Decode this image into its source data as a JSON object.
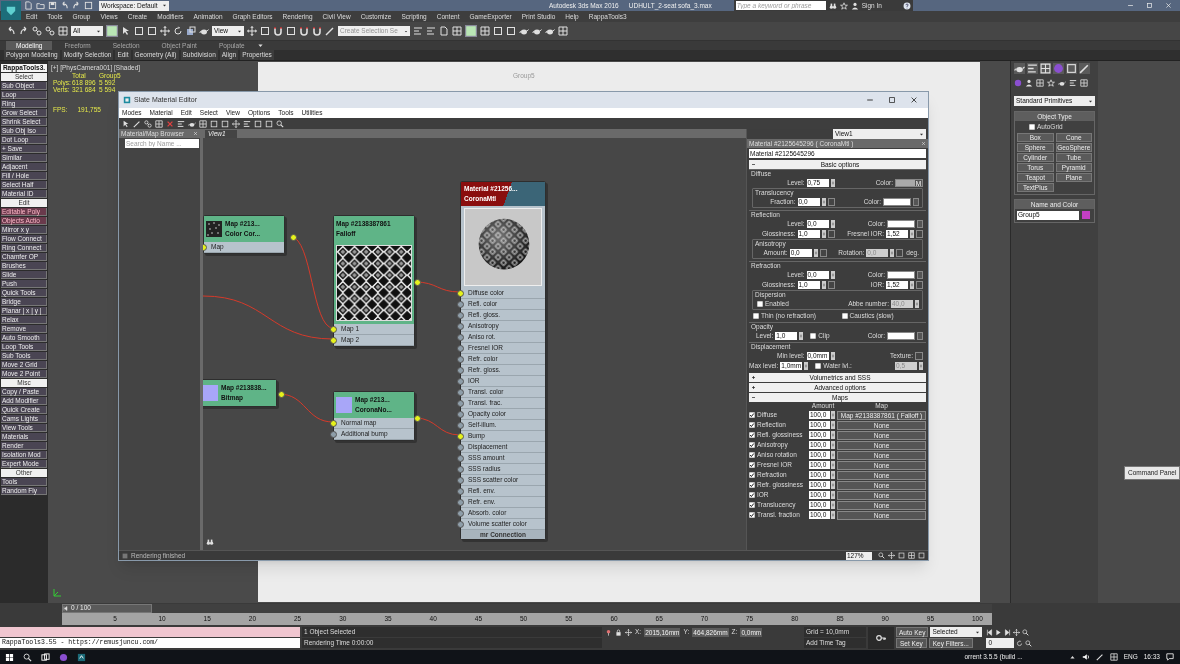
{
  "app": {
    "workspace": "Workspace: Default",
    "title": "Autodesk 3ds Max 2016",
    "file": "UDHULT_2-seat sofa_3.max",
    "search": {
      "placeholder": "Type a keyword or phrase"
    },
    "sign_in": "Sign In"
  },
  "menu": [
    "Edit",
    "Tools",
    "Group",
    "Views",
    "Create",
    "Modifiers",
    "Animation",
    "Graph Editors",
    "Rendering",
    "Civil View",
    "Customize",
    "Scripting",
    "Content",
    "GameExporter",
    "Print Studio",
    "Help",
    "RappaTools3"
  ],
  "toolbar": {
    "filter": "All",
    "reference": "View",
    "selection_set": {
      "placeholder": "Create Selection Se"
    }
  },
  "ribbon": {
    "tabs": [
      {
        "label": "Modeling",
        "selected": true
      },
      {
        "label": "Freeform",
        "selected": false
      },
      {
        "label": "Selection",
        "selected": false
      },
      {
        "label": "Object Paint",
        "selected": false
      },
      {
        "label": "Populate",
        "selected": false
      }
    ],
    "panels": [
      "Polygon Modeling",
      "Modify Selection",
      "Edit",
      "Geometry (All)",
      "Subdivision",
      "Align",
      "Properties"
    ]
  },
  "rappatools": [
    {
      "kind": "title",
      "label": "RappaTools3."
    },
    {
      "kind": "header",
      "label": "Select"
    },
    {
      "kind": "button",
      "label": "Sub Object",
      "highlighted": false
    },
    {
      "kind": "button",
      "label": "Loop",
      "highlighted": false
    },
    {
      "kind": "button",
      "label": "Ring",
      "highlighted": false
    },
    {
      "kind": "button",
      "label": "Grow Select",
      "highlighted": false
    },
    {
      "kind": "button",
      "label": "Shrink Select",
      "highlighted": false
    },
    {
      "kind": "button",
      "label": "Sub Obj Iso",
      "highlighted": false
    },
    {
      "kind": "button",
      "label": "Dot Loop",
      "highlighted": false
    },
    {
      "kind": "button",
      "label": "+ Save",
      "highlighted": false
    },
    {
      "kind": "button",
      "label": "Similar",
      "highlighted": false
    },
    {
      "kind": "button",
      "label": "Adjacent",
      "highlighted": false
    },
    {
      "kind": "button",
      "label": "Fill / Hole",
      "highlighted": false
    },
    {
      "kind": "button",
      "label": "Select Half",
      "highlighted": false
    },
    {
      "kind": "button",
      "label": "Material ID",
      "highlighted": false
    },
    {
      "kind": "header",
      "label": "Edit"
    },
    {
      "kind": "button",
      "label": "Editable Poly",
      "highlighted": true
    },
    {
      "kind": "button",
      "label": "Objects Actio",
      "highlighted": true
    },
    {
      "kind": "button",
      "label": "Mirror  x  y",
      "highlighted": false
    },
    {
      "kind": "button",
      "label": "Flow Connect",
      "highlighted": false
    },
    {
      "kind": "button",
      "label": "Ring Connect",
      "highlighted": false
    },
    {
      "kind": "button",
      "label": "Chamfer OP",
      "highlighted": false
    },
    {
      "kind": "button",
      "label": "Brushes",
      "highlighted": false
    },
    {
      "kind": "button",
      "label": "Slide",
      "highlighted": false
    },
    {
      "kind": "button",
      "label": "Push",
      "highlighted": false
    },
    {
      "kind": "button",
      "label": "Quick Tools",
      "highlighted": false
    },
    {
      "kind": "button",
      "label": "Bridge",
      "highlighted": false
    },
    {
      "kind": "button",
      "label": "Planar | x | y |",
      "highlighted": false
    },
    {
      "kind": "button",
      "label": "Relax",
      "highlighted": false
    },
    {
      "kind": "button",
      "label": "Remove",
      "highlighted": false
    },
    {
      "kind": "button",
      "label": "Auto Smooth",
      "highlighted": false
    },
    {
      "kind": "button",
      "label": "Loop Tools",
      "highlighted": false
    },
    {
      "kind": "button",
      "label": "Sub Tools",
      "highlighted": false
    },
    {
      "kind": "button",
      "label": "Move 2 Grid",
      "highlighted": false
    },
    {
      "kind": "button",
      "label": "Move 2 Point",
      "highlighted": false
    },
    {
      "kind": "header",
      "label": "Misc"
    },
    {
      "kind": "button",
      "label": "Copy / Paste",
      "highlighted": false
    },
    {
      "kind": "button",
      "label": "Add Modifier",
      "highlighted": false
    },
    {
      "kind": "button",
      "label": "Quick Create",
      "highlighted": false
    },
    {
      "kind": "button",
      "label": "Cams Lights",
      "highlighted": false
    },
    {
      "kind": "button",
      "label": "View Tools",
      "highlighted": false
    },
    {
      "kind": "button",
      "label": "Materials",
      "highlighted": false
    },
    {
      "kind": "button",
      "label": "Render",
      "highlighted": false
    },
    {
      "kind": "button",
      "label": "Isolation Mod",
      "highlighted": false
    },
    {
      "kind": "button",
      "label": "Expert Mode",
      "highlighted": false
    },
    {
      "kind": "header",
      "label": "Other"
    },
    {
      "kind": "button",
      "label": "Tools",
      "highlighted": false
    },
    {
      "kind": "button",
      "label": "Random Fly",
      "highlighted": false
    }
  ],
  "viewport": {
    "label": "[+] [PhysCamera001] [Shaded]",
    "stats": {
      "columns": [
        "Total",
        "Group5"
      ],
      "rows": [
        {
          "label": "Polys:",
          "values": [
            "618 896",
            "5 592"
          ]
        },
        {
          "label": "Verts:",
          "values": [
            "321 684",
            "5 594"
          ]
        }
      ]
    },
    "fps": {
      "label": "FPS:",
      "value": "191,755"
    },
    "object_label": "Group5"
  },
  "slate": {
    "title": "Slate Material Editor",
    "menu": [
      "Modes",
      "Material",
      "Edit",
      "Select",
      "View",
      "Options",
      "Tools",
      "Utilities"
    ],
    "browser": {
      "title": "Material/Map Browser",
      "search": {
        "placeholder": "Search by Name ..."
      }
    },
    "view_tabs": [
      {
        "label": "View1",
        "selected": true
      }
    ],
    "view_select": "View1",
    "nodes": [
      {
        "kind": "map",
        "title": "Map #213...",
        "subtitle": "Color Cor...",
        "ports": [
          {
            "label": "Map",
            "connected": true
          }
        ]
      },
      {
        "kind": "map",
        "title": "Map #2138387861",
        "subtitle": "Falloff",
        "ports": [
          {
            "label": "Map 1",
            "connected": true
          },
          {
            "label": "Map 2",
            "connected": true
          }
        ]
      },
      {
        "kind": "map",
        "title": "Map #213838...",
        "subtitle": "Bitmap"
      },
      {
        "kind": "map",
        "title": "Map #213...",
        "subtitle": "CoronaNo...",
        "ports": [
          {
            "label": "Normal map",
            "connected": true
          },
          {
            "label": "Additional bump",
            "connected": false
          }
        ]
      },
      {
        "kind": "material",
        "title": "Material #21256...",
        "subtitle": "CoronaMtl",
        "footer": "mr Connection",
        "ports": [
          {
            "label": "Diffuse color",
            "connected": true
          },
          {
            "label": "Refl. color",
            "connected": false
          },
          {
            "label": "Refl. gloss.",
            "connected": false
          },
          {
            "label": "Anisotropy",
            "connected": false
          },
          {
            "label": "Aniso rot.",
            "connected": false
          },
          {
            "label": "Fresnel IOR",
            "connected": false
          },
          {
            "label": "Refr. color",
            "connected": false
          },
          {
            "label": "Refr. gloss.",
            "connected": false
          },
          {
            "label": "IOR",
            "connected": false
          },
          {
            "label": "Transl. color",
            "connected": false
          },
          {
            "label": "Transl. frac.",
            "connected": false
          },
          {
            "label": "Opacity color",
            "connected": false
          },
          {
            "label": "Self-illum.",
            "connected": false
          },
          {
            "label": "Bump",
            "connected": true
          },
          {
            "label": "Displacement",
            "connected": false
          },
          {
            "label": "SSS amount",
            "connected": false
          },
          {
            "label": "SSS radius",
            "connected": false
          },
          {
            "label": "SSS scatter color",
            "connected": false
          },
          {
            "label": "Refl. env.",
            "connected": false
          },
          {
            "label": "Refr. env.",
            "connected": false
          },
          {
            "label": "Absorb. color",
            "connected": false
          },
          {
            "label": "Volume scatter color",
            "connected": false
          }
        ]
      }
    ],
    "status": "Rendering finished",
    "zoom": "127%"
  },
  "properties": {
    "header": "Material #2125645296 ( CoronaMtl )",
    "name": "Material #2125645296",
    "basic": {
      "title": "Basic options",
      "expanded": true,
      "groups": [
        {
          "title": "Diffuse",
          "items": [
            {
              "kind": "row",
              "cells": [
                {
                  "kind": "spinner",
                  "label": "Level:",
                  "value": "0,75",
                  "slot": false,
                  "disabled": false
                },
                {
                  "kind": "color",
                  "label": "Color:",
                  "color": "#a9a9a9",
                  "map_text": "M"
                }
              ]
            },
            {
              "kind": "group",
              "title": "Translucency",
              "items": [
                {
                  "kind": "row",
                  "cells": [
                    {
                      "kind": "spinner",
                      "label": "Fraction:",
                      "value": "0,0",
                      "slot": true,
                      "disabled": false
                    },
                    {
                      "kind": "color",
                      "label": "Color:",
                      "color": "#ffffff"
                    }
                  ]
                }
              ]
            }
          ]
        },
        {
          "title": "Reflection",
          "items": [
            {
              "kind": "row",
              "cells": [
                {
                  "kind": "spinner",
                  "label": "Level:",
                  "value": "0,0",
                  "slot": false,
                  "disabled": false
                },
                {
                  "kind": "color",
                  "label": "Color:",
                  "color": "#ffffff"
                }
              ]
            },
            {
              "kind": "row",
              "cells": [
                {
                  "kind": "spinner",
                  "label": "Glossiness:",
                  "value": "1,0",
                  "slot": true,
                  "disabled": false
                },
                {
                  "kind": "spinner",
                  "label": "Fresnel IOR:",
                  "value": "1,52",
                  "slot": true,
                  "disabled": false
                }
              ]
            },
            {
              "kind": "group",
              "title": "Anisotropy",
              "items": [
                {
                  "kind": "row",
                  "cells": [
                    {
                      "kind": "spinner",
                      "label": "Amount:",
                      "value": "0,0",
                      "slot": true,
                      "disabled": false
                    },
                    {
                      "kind": "spinner",
                      "label": "Rotation:",
                      "value": "0,0",
                      "slot": true,
                      "disabled": true
                    },
                    {
                      "kind": "unit",
                      "text": "deg."
                    }
                  ]
                }
              ]
            }
          ]
        },
        {
          "title": "Refraction",
          "items": [
            {
              "kind": "row",
              "cells": [
                {
                  "kind": "spinner",
                  "label": "Level:",
                  "value": "0,0",
                  "slot": false,
                  "disabled": false
                },
                {
                  "kind": "color",
                  "label": "Color:",
                  "color": "#ffffff"
                }
              ]
            },
            {
              "kind": "row",
              "cells": [
                {
                  "kind": "spinner",
                  "label": "Glossiness:",
                  "value": "1,0",
                  "slot": true,
                  "disabled": false
                },
                {
                  "kind": "spinner",
                  "label": "IOR:",
                  "value": "1,52",
                  "slot": true,
                  "disabled": false
                }
              ]
            },
            {
              "kind": "group",
              "title": "Dispersion",
              "items": [
                {
                  "kind": "row",
                  "cells": [
                    {
                      "kind": "checkbox",
                      "label": "Enabled",
                      "checked": false
                    },
                    {
                      "kind": "spinner",
                      "label": "Abbe number:",
                      "value": "40,0",
                      "slot": false,
                      "disabled": true
                    }
                  ]
                }
              ]
            },
            {
              "kind": "row",
              "cells": [
                {
                  "kind": "checkbox",
                  "label": "Thin (no refraction)",
                  "checked": false
                },
                {
                  "kind": "checkbox",
                  "label": "Caustics (slow)",
                  "checked": false
                }
              ]
            }
          ]
        },
        {
          "title": "Opacity",
          "items": [
            {
              "kind": "row",
              "cells": [
                {
                  "kind": "spinner",
                  "label": "Level:",
                  "value": "1,0",
                  "slot": false,
                  "disabled": false
                },
                {
                  "kind": "checkbox",
                  "label": "Clip",
                  "checked": false
                },
                {
                  "kind": "color",
                  "label": "Color:",
                  "color": "#ffffff"
                }
              ]
            }
          ]
        },
        {
          "title": "Displacement",
          "items": [
            {
              "kind": "row",
              "cells": [
                {
                  "kind": "spinner",
                  "label": "Min level:",
                  "value": "0,0mm",
                  "slot": false,
                  "disabled": false
                },
                {
                  "kind": "slot",
                  "label": "Texture:"
                }
              ]
            },
            {
              "kind": "row",
              "cells": [
                {
                  "kind": "spinner",
                  "label": "Max level:",
                  "value": "1,0mm",
                  "slot": false,
                  "disabled": false
                },
                {
                  "kind": "checkbox",
                  "label": "Water lvl.:",
                  "checked": false
                },
                {
                  "kind": "spinner",
                  "value": "0,5",
                  "slot": false,
                  "disabled": true
                }
              ]
            }
          ]
        }
      ]
    },
    "rollouts": [
      {
        "title": "Volumetrics and SSS",
        "expanded": false
      },
      {
        "title": "Advanced options",
        "expanded": false
      }
    ],
    "maps": {
      "title": "Maps",
      "expanded": true,
      "columns": [
        "Amount",
        "Map"
      ],
      "rows": [
        {
          "label": "Diffuse",
          "enabled": true,
          "amount": "100,0",
          "map": "Map #2138387861 ( Falloff )"
        },
        {
          "label": "Reflection",
          "enabled": true,
          "amount": "100,0",
          "map": "None"
        },
        {
          "label": "Refl. glossiness",
          "enabled": true,
          "amount": "100,0",
          "map": "None"
        },
        {
          "label": "Anisotropy",
          "enabled": true,
          "amount": "100,0",
          "map": "None"
        },
        {
          "label": "Aniso rotation",
          "enabled": true,
          "amount": "100,0",
          "map": "None"
        },
        {
          "label": "Fresnel IOR",
          "enabled": true,
          "amount": "100,0",
          "map": "None"
        },
        {
          "label": "Refraction",
          "enabled": true,
          "amount": "100,0",
          "map": "None"
        },
        {
          "label": "Refr. glossiness",
          "enabled": true,
          "amount": "100,0",
          "map": "None"
        },
        {
          "label": "IOR",
          "enabled": true,
          "amount": "100,0",
          "map": "None"
        },
        {
          "label": "Translucency",
          "enabled": true,
          "amount": "100,0",
          "map": "None"
        },
        {
          "label": "Transl. fraction",
          "enabled": true,
          "amount": "100,0",
          "map": "None"
        }
      ]
    }
  },
  "command_panel": {
    "category": "Standard Primitives",
    "object_type": {
      "title": "Object Type",
      "autogrid": {
        "label": "AutoGrid",
        "checked": false
      },
      "buttons": [
        "Box",
        "Cone",
        "Sphere",
        "GeoSphere",
        "Cylinder",
        "Tube",
        "Torus",
        "Pyramid",
        "Teapot",
        "Plane",
        "TextPlus"
      ]
    },
    "name_and_color": {
      "title": "Name and Color",
      "name": "Group5",
      "color": "#c23fc2"
    },
    "tooltip": "Command Panel"
  },
  "timeline": {
    "position": "0 / 100",
    "level": 0,
    "ticks": [
      "5",
      "10",
      "15",
      "20",
      "25",
      "30",
      "35",
      "40",
      "45",
      "50",
      "55",
      "60",
      "65",
      "70",
      "75",
      "80",
      "85",
      "90",
      "95",
      "100"
    ]
  },
  "status": {
    "script_line": "RappaTools3.55 - https://remusjuncu.com/",
    "selection": "1 Object Selected",
    "rendering_time": "Rendering Time  0:00:00",
    "coords": [
      {
        "label": "X:",
        "value": "2015,16mm"
      },
      {
        "label": "Y:",
        "value": "464,826mm"
      },
      {
        "label": "Z:",
        "value": "0,0mm"
      }
    ],
    "grid": "Grid = 10,0mm",
    "add_time_tag": "Add Time Tag",
    "auto_key": "Auto Key",
    "set_key": "Set Key",
    "key_mode": "Selected",
    "key_filters": "Key Filters...",
    "frame": "0"
  },
  "taskbar": {
    "app_text": "orrent 3.5.5  (build ...",
    "language": "ENG",
    "time": "16:33"
  }
}
